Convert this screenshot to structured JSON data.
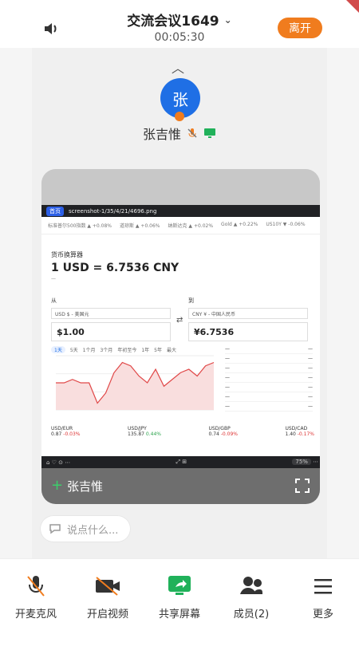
{
  "header": {
    "title": "交流会议1649",
    "timer": "00:05:30",
    "leave_label": "离开",
    "accent": "#f07c1e"
  },
  "main": {
    "avatar_text": "张",
    "presenter_name": "张吉惟",
    "share": {
      "sharer_name": "张吉惟",
      "inner": {
        "tab_label": "首页",
        "file_name": "screenshot-1/35/4/21/4696.png",
        "ticker": [
          "标准普尔500指数 ▲ +0.08%",
          "道琼斯 ▲ +0.06%",
          "纳斯达克 ▲ +0.02%",
          "Gold ▲ +0.22%",
          "US10Y ▼ -0.06%"
        ],
        "converter_title": "货币换算器",
        "rate_text": "1 USD = 6.7536 CNY",
        "from_label": "从",
        "to_label": "到",
        "from_currency": "USD $ - 美国元",
        "to_currency": "CNY ¥ - 中国人民币",
        "from_amount": "$1.00",
        "to_amount": "¥6.7536",
        "ranges": [
          "1天",
          "5天",
          "1个月",
          "3个月",
          "年初至今",
          "1年",
          "5年",
          "最大"
        ],
        "metrics": [
          {
            "name": "USD/EUR",
            "value": "0.87",
            "change": "-0.03%",
            "type": "neg"
          },
          {
            "name": "USD/JPY",
            "value": "135.87",
            "change": "0.44%",
            "type": "pos"
          },
          {
            "name": "USD/GBP",
            "value": "0.74",
            "change": "-0.09%",
            "type": "neg"
          },
          {
            "name": "USD/CAD",
            "value": "1.40",
            "change": "-0.17%",
            "type": "neg"
          }
        ],
        "zoom": "75%",
        "chart_data": {
          "type": "line",
          "x": [
            0,
            1,
            2,
            3,
            4,
            5,
            6,
            7,
            8,
            9,
            10,
            11,
            12,
            13,
            14,
            15,
            16,
            17,
            18,
            19
          ],
          "values": [
            6.752,
            6.752,
            6.753,
            6.752,
            6.752,
            6.746,
            6.749,
            6.755,
            6.758,
            6.757,
            6.754,
            6.752,
            6.756,
            6.751,
            6.753,
            6.755,
            6.756,
            6.754,
            6.757,
            6.758
          ],
          "ylim": [
            6.744,
            6.76
          ]
        }
      }
    }
  },
  "comment": {
    "placeholder": "说点什么..."
  },
  "toolbar": {
    "items": [
      {
        "label": "开麦克风"
      },
      {
        "label": "开启视频"
      },
      {
        "label": "共享屏幕"
      },
      {
        "label": "成员(2)"
      },
      {
        "label": "更多"
      }
    ]
  }
}
